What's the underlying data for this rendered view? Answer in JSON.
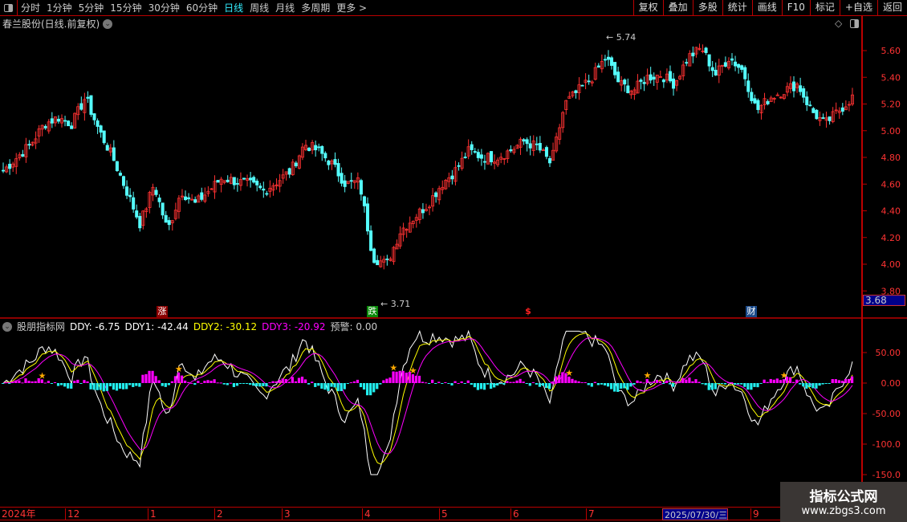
{
  "toolbar": {
    "periods": [
      "分时",
      "1分钟",
      "5分钟",
      "15分钟",
      "30分钟",
      "60分钟",
      "日线",
      "周线",
      "月线",
      "多周期",
      "更多 >"
    ],
    "active": "日线",
    "buttons": [
      "复权",
      "叠加",
      "多股",
      "统计",
      "画线",
      "F10",
      "标记",
      "+自选",
      "返回"
    ]
  },
  "title": "春兰股份(日线.前复权)",
  "indicator": {
    "name": "股朋指标网",
    "ddy": "DDY: -6.75",
    "ddy1": "DDY1: -42.44",
    "ddy2": "DDY2: -30.12",
    "ddy3": "DDY3: -20.92",
    "warn": "预警: 0.00"
  },
  "price_axis": [
    "5.60",
    "5.40",
    "5.20",
    "5.00",
    "4.80",
    "4.60",
    "4.40",
    "4.20",
    "4.00",
    "3.80"
  ],
  "current_price_box": "3.68",
  "ind_axis": [
    "50.00",
    "0.00",
    "-50.00",
    "-100.0",
    "-150.0"
  ],
  "high_label": "5.74",
  "low_label": "3.71",
  "markers": [
    "涨",
    "跌",
    "$",
    "财"
  ],
  "dates": [
    "2024年",
    "12",
    "1",
    "2",
    "3",
    "4",
    "5",
    "6",
    "7",
    "2025/07/30/三",
    "9"
  ],
  "watermark": {
    "name": "指标公式网",
    "url": "www.zbgs3.com"
  },
  "colors": {
    "up": "#ff3232",
    "down": "#54fcfc",
    "ddy": "#ffffff",
    "ddy1": "#ffff00",
    "ddy2": "#ff00ff"
  },
  "chart_data": {
    "type": "candlestick",
    "price_range": [
      3.7,
      5.75
    ],
    "indicator_range": [
      -160,
      100
    ],
    "closes": [
      4.7,
      4.8,
      4.9,
      5.05,
      5.1,
      5.05,
      5.25,
      5.0,
      4.8,
      4.55,
      4.3,
      4.6,
      4.25,
      4.55,
      4.45,
      4.55,
      4.65,
      4.62,
      4.6,
      4.55,
      4.62,
      4.7,
      4.9,
      4.85,
      4.75,
      4.6,
      4.62,
      4.05,
      4.0,
      4.25,
      4.35,
      4.45,
      4.6,
      4.7,
      4.85,
      4.8,
      4.8,
      4.85,
      4.92,
      4.88,
      4.75,
      5.2,
      5.3,
      5.4,
      5.55,
      5.35,
      5.3,
      5.4,
      5.42,
      5.35,
      5.55,
      5.62,
      5.42,
      5.55,
      5.45,
      5.15,
      5.25,
      5.3,
      5.35,
      5.15,
      5.05,
      5.15,
      5.25
    ]
  }
}
